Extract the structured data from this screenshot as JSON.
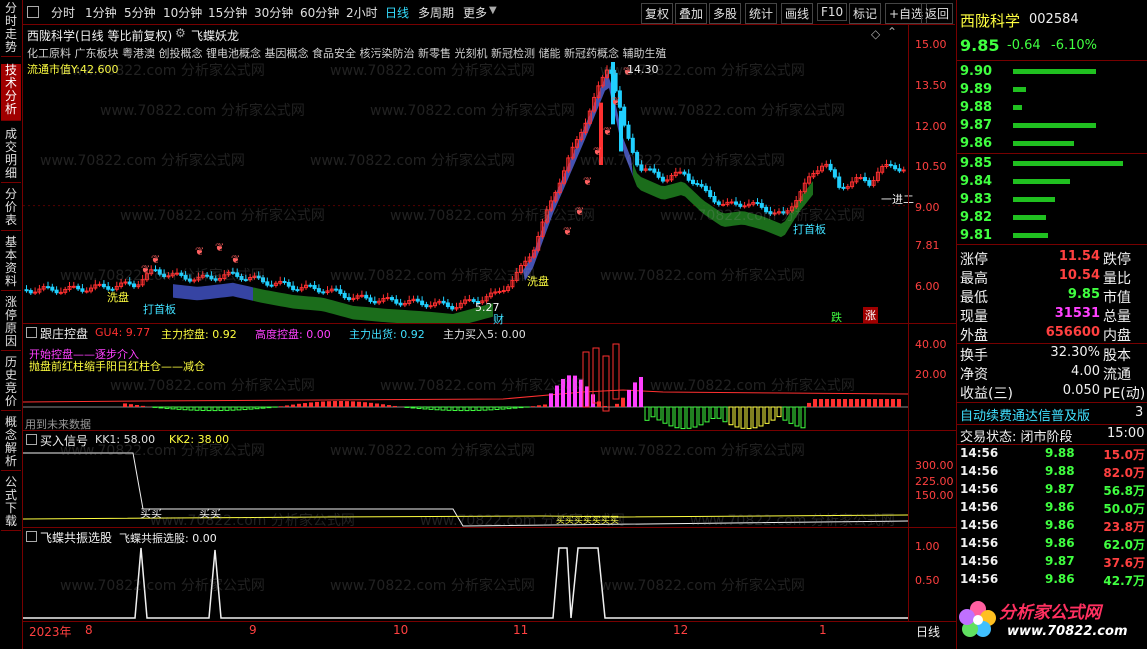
{
  "left_tabs": [
    "分时走势",
    "技术分析",
    "成交明细",
    "分价表",
    "基本资料",
    "涨停原因",
    "历史竞价",
    "概念解析",
    "公式下载"
  ],
  "toolbar": {
    "periods": [
      "分时",
      "1分钟",
      "5分钟",
      "10分钟",
      "15分钟",
      "30分钟",
      "60分钟",
      "2小时",
      "日线",
      "多周期",
      "更多"
    ],
    "selected": "日线",
    "right_buttons": [
      "复权",
      "叠加",
      "多股",
      "统计",
      "画线",
      "F10",
      "标记",
      "+自选",
      "返回"
    ]
  },
  "main_chart": {
    "title": "西陇科学(日线 等比前复权)",
    "indicator": "飞蝶妖龙",
    "concepts": "化工原料 广东板块 粤港澳 创投概念 锂电池概念 基因概念 食品安全 核污染防治 新零售 光刻机 新冠检测 储能 新冠药概念 辅助生殖",
    "market_cap": "流通市值Y:42.600",
    "price_axis": [
      "15.00",
      "13.50",
      "12.00",
      "10.50",
      "9.00",
      "7.81",
      "6.00"
    ],
    "high_label": "14.30",
    "low_label": "5.27",
    "marks": {
      "lead": "一进二",
      "first_board": "打首板",
      "wash": "洗盘",
      "cai": "财",
      "die": "跌",
      "zhang": "涨"
    }
  },
  "panel2": {
    "title": "跟庄控盘",
    "values": [
      {
        "label": "GU4: 9.77",
        "color": "#ff3030"
      },
      {
        "label": "主力控盘: 0.92",
        "color": "#ffff40"
      },
      {
        "label": "高度控盘: 0.00",
        "color": "#ff40ff"
      },
      {
        "label": "主力出货: 0.92",
        "color": "#40e0ff"
      },
      {
        "label": "主力买入5: 0.00",
        "color": "#e0e0e0"
      }
    ],
    "axis": [
      "40.00",
      "20.00"
    ],
    "legend_lines": [
      "开始控盘——逐步介入",
      "抛盘前红柱缩手阳日红柱仓——减仓"
    ],
    "footer": "用到未来数据"
  },
  "panel3": {
    "title": "买入信号",
    "values": [
      {
        "label": "KK1: 58.00",
        "color": "#e0e0e0"
      },
      {
        "label": "KK2: 38.00",
        "color": "#ffff40"
      }
    ],
    "axis": [
      "300.00",
      "225.00",
      "150.00"
    ],
    "buy_labels": [
      "买买",
      "买买",
      "买买买买买买买"
    ]
  },
  "panel4": {
    "title": "飞蝶共振选股",
    "value": "飞蝶共振选股: 0.00",
    "axis": [
      "1.00",
      "0.50"
    ]
  },
  "time_axis": [
    "2023年",
    "8",
    "9",
    "10",
    "11",
    "12",
    "1"
  ],
  "period_label": "日线",
  "stock": {
    "name": "西陇科学",
    "code": "002584",
    "price": "9.85",
    "change": "-0.64",
    "pct": "-6.10%"
  },
  "order_book": {
    "asks": [
      {
        "price": "9.90",
        "vol": 0.75
      },
      {
        "price": "9.89",
        "vol": 0.12
      },
      {
        "price": "9.88",
        "vol": 0.08
      },
      {
        "price": "9.87",
        "vol": 0.75
      },
      {
        "price": "9.86",
        "vol": 0.55
      }
    ],
    "bids": [
      {
        "price": "9.85",
        "vol": 1.0
      },
      {
        "price": "9.84",
        "vol": 0.52
      },
      {
        "price": "9.83",
        "vol": 0.38
      },
      {
        "price": "9.82",
        "vol": 0.3
      },
      {
        "price": "9.81",
        "vol": 0.32
      }
    ]
  },
  "quote": [
    {
      "l1": "涨停",
      "v1": "11.54",
      "c1": "#ff4040",
      "l2": "跌停",
      "v2": "",
      "c2": "#40ff40"
    },
    {
      "l1": "最高",
      "v1": "10.54",
      "c1": "#ff4040",
      "l2": "量比",
      "v2": "",
      "c2": "#f0f0f0"
    },
    {
      "l1": "最低",
      "v1": "9.85",
      "c1": "#40ff40",
      "l2": "市值",
      "v2": "",
      "c2": "#f0f0f0"
    },
    {
      "l1": "现量",
      "v1": "31531",
      "c1": "#ff40ff",
      "l2": "总量",
      "v2": "",
      "c2": "#f0f0f0"
    },
    {
      "l1": "外盘",
      "v1": "656600",
      "c1": "#ff4040",
      "l2": "内盘",
      "v2": "",
      "c2": "#f0f0f0"
    }
  ],
  "quote2": [
    {
      "l1": "换手",
      "v1": "32.30%",
      "c1": "#f0f0f0",
      "l2": "股本",
      "v2": ""
    },
    {
      "l1": "净资",
      "v1": "4.00",
      "c1": "#f0f0f0",
      "l2": "流通",
      "v2": ""
    },
    {
      "l1": "收益(三)",
      "v1": "0.050",
      "c1": "#f0f0f0",
      "l2": "PE(动)",
      "v2": ""
    }
  ],
  "ad_banner": "自动续费通达信普及版",
  "ad_num": "3",
  "trade_status": {
    "label": "交易状态: 闭市阶段",
    "time": "15:00"
  },
  "ticks": [
    {
      "t": "14:56",
      "p": "9.88",
      "v": "15.0万",
      "c": "#ff4040"
    },
    {
      "t": "14:56",
      "p": "9.88",
      "v": "82.0万",
      "c": "#ff4040"
    },
    {
      "t": "14:56",
      "p": "9.87",
      "v": "56.8万",
      "c": "#40ff40"
    },
    {
      "t": "14:56",
      "p": "9.86",
      "v": "50.0万",
      "c": "#40ff40"
    },
    {
      "t": "14:56",
      "p": "9.86",
      "v": "23.8万",
      "c": "#ff4040"
    },
    {
      "t": "14:56",
      "p": "9.86",
      "v": "62.0万",
      "c": "#40ff40"
    },
    {
      "t": "14:56",
      "p": "9.87",
      "v": "37.6万",
      "c": "#ff4040"
    },
    {
      "t": "14:56",
      "p": "9.86",
      "v": "42.7万",
      "c": "#40ff40"
    }
  ],
  "logo": {
    "text": "分析家公式网",
    "url": "www.70822.com"
  },
  "watermark": "www.70822.com 分析家公式网"
}
